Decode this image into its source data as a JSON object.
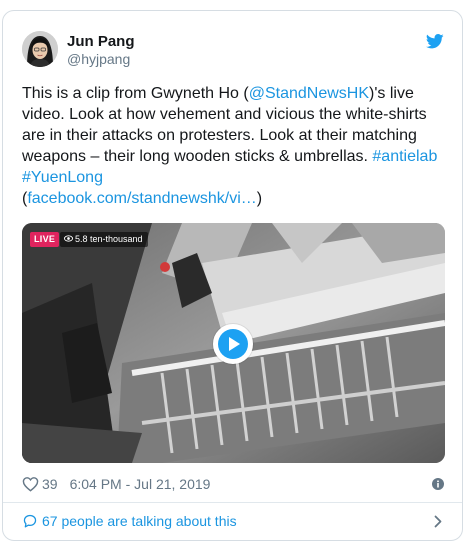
{
  "tweet": {
    "author": {
      "name": "Jun Pang",
      "handle": "@hyjpang",
      "avatar_icon": "avatar-photo"
    },
    "brand_icon": "twitter-bird-icon",
    "text": {
      "line1_pre": "This is a clip from Gwyneth Ho (",
      "line1_mention": "@StandNewsHK",
      "line1_post": ")'s live",
      "line2": "video. Look at how vehement and vicious the white-shirts",
      "line3": "are in their attacks on protesters. Look at their matching",
      "line4_pre": "weapons – their long wooden sticks & umbrellas. ",
      "line4_hashtag": "#antielab",
      "line5_hashtag": "#YuenLong",
      "line6_open": "(",
      "line6_link": "facebook.com/standnewshk/vi…",
      "line6_close": ")"
    },
    "media": {
      "live_label": "LIVE",
      "views_label": "5.8 ten-thousand",
      "play_icon": "play-icon"
    },
    "meta": {
      "like_count": "39",
      "timestamp": "6:04 PM - Jul 21, 2019",
      "info_icon": "info-icon"
    },
    "footer": {
      "talking_text": "67 people are talking about this"
    },
    "colors": {
      "link": "#1b95e0",
      "brand": "#1da1f2",
      "muted": "#657786",
      "live": "#e0245e"
    }
  }
}
